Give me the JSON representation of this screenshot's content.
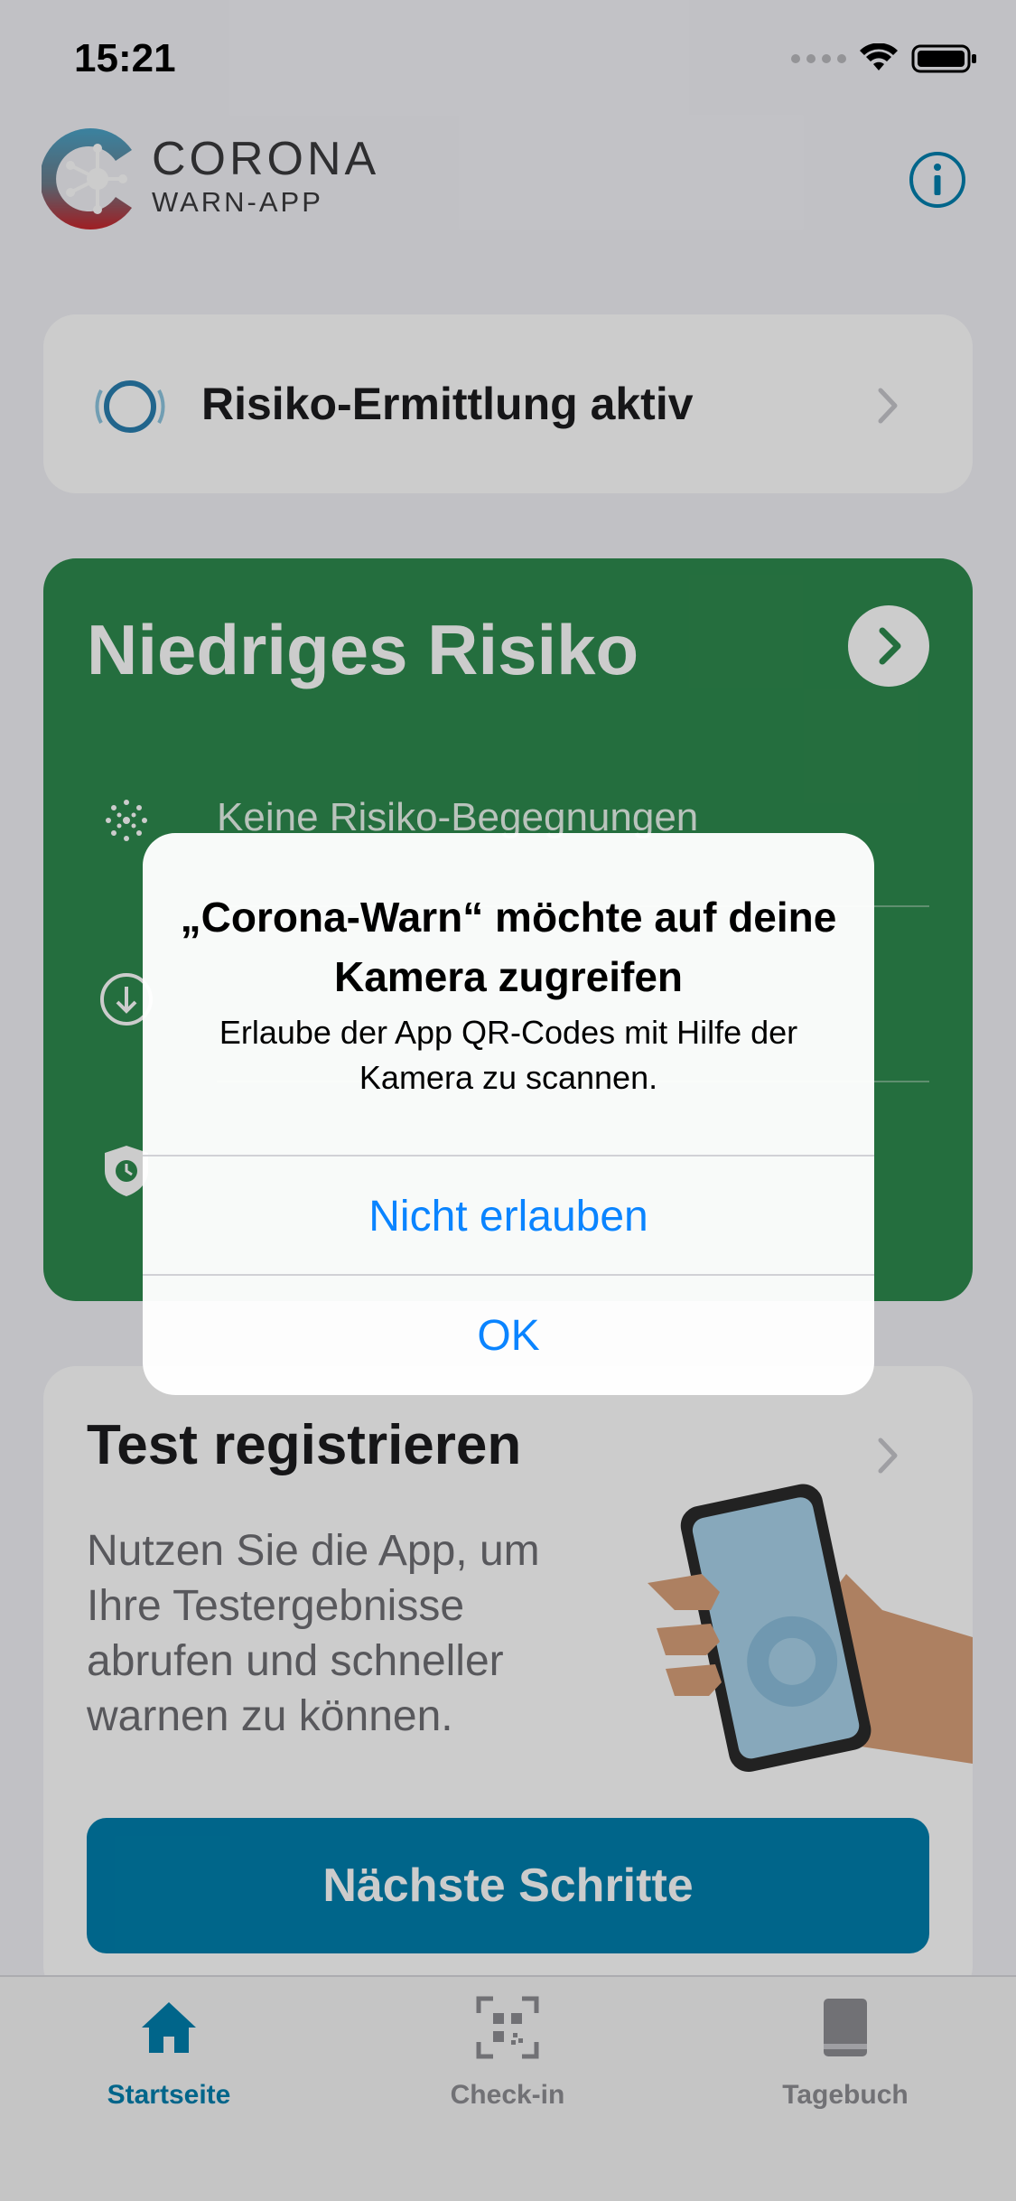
{
  "status_bar": {
    "time": "15:21"
  },
  "header": {
    "logo_line1": "CORONA",
    "logo_line2": "WARN-APP",
    "info_icon": "info-circle-icon"
  },
  "risk_detection": {
    "label": "Risiko-Ermittlung aktiv"
  },
  "risk_card": {
    "title": "Niedriges Risiko",
    "rows": [
      {
        "text": "Keine Risiko-Begegnungen",
        "icon": "virus-dots-icon"
      }
    ],
    "color": "#2e8a4e"
  },
  "test_card": {
    "title": "Test registrieren",
    "description": "Nutzen Sie die App, um Ihre Testergebnisse abrufen und schneller warnen zu können.",
    "button_label": "Nächste Schritte",
    "button_color": "#007fad"
  },
  "tabs": [
    {
      "label": "Startseite",
      "icon": "home-icon",
      "active": true
    },
    {
      "label": "Check-in",
      "icon": "qr-scan-icon",
      "active": false
    },
    {
      "label": "Tagebuch",
      "icon": "book-icon",
      "active": false
    }
  ],
  "alert": {
    "title": "„Corona-Warn“ möchte auf deine Kamera zugreifen",
    "message": "Erlaube der App QR-Codes mit Hilfe der Kamera zu scannen.",
    "deny_label": "Nicht erlauben",
    "ok_label": "OK"
  }
}
